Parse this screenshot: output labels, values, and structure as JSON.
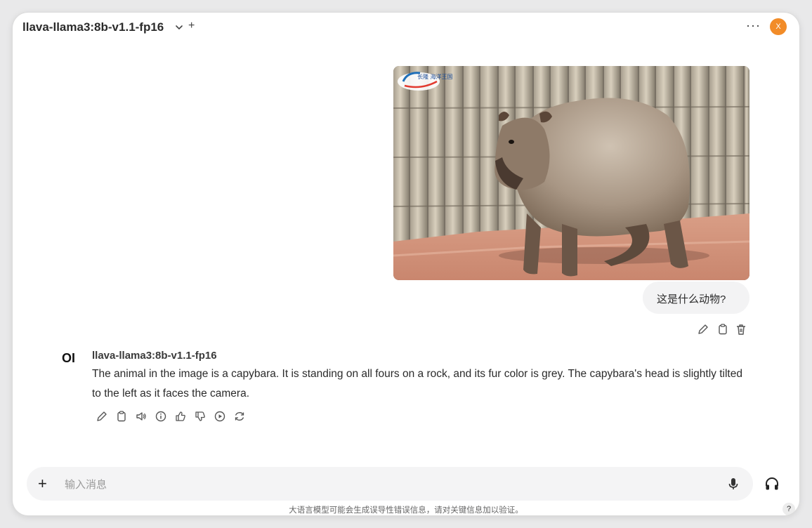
{
  "header": {
    "model_title": "llava-llama3:8b-v1.1-fp16",
    "new_model_symbol": "+",
    "menu_symbol": "···",
    "avatar_initial": "X"
  },
  "user_message": {
    "image_watermark": "长隆 海洋王国",
    "text": "这是什么动物?",
    "actions": [
      "pencil-icon",
      "clipboard-icon",
      "trash-icon"
    ]
  },
  "assistant_message": {
    "logo": "OI",
    "model_name": "llava-llama3:8b-v1.1-fp16",
    "text": "The animal in the image is a capybara. It is standing on all fours on a rock, and its fur color is grey. The capybara's head is slightly tilted to the left as it faces the camera.",
    "actions": [
      "pencil-icon",
      "clipboard-icon",
      "speaker-icon",
      "info-icon",
      "thumbs-up-icon",
      "thumbs-down-icon",
      "play-icon",
      "regenerate-icon"
    ]
  },
  "composer": {
    "plus_symbol": "+",
    "placeholder": "输入消息",
    "value": ""
  },
  "disclaimer": "大语言模型可能会生成误导性错误信息，请对关键信息加以验证。",
  "help_symbol": "?",
  "colors": {
    "avatar": "#f28c28",
    "bubble": "#f3f3f4",
    "input_bg": "#f4f4f5"
  }
}
